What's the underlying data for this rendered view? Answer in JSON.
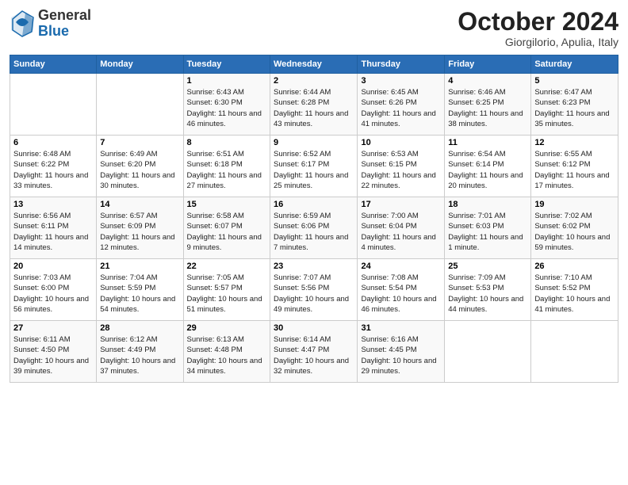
{
  "logo": {
    "general": "General",
    "blue": "Blue"
  },
  "header": {
    "month": "October 2024",
    "location": "Giorgilorio, Apulia, Italy"
  },
  "days_of_week": [
    "Sunday",
    "Monday",
    "Tuesday",
    "Wednesday",
    "Thursday",
    "Friday",
    "Saturday"
  ],
  "weeks": [
    [
      {
        "day": null
      },
      {
        "day": null
      },
      {
        "day": 1,
        "sunrise": "Sunrise: 6:43 AM",
        "sunset": "Sunset: 6:30 PM",
        "daylight": "Daylight: 11 hours and 46 minutes."
      },
      {
        "day": 2,
        "sunrise": "Sunrise: 6:44 AM",
        "sunset": "Sunset: 6:28 PM",
        "daylight": "Daylight: 11 hours and 43 minutes."
      },
      {
        "day": 3,
        "sunrise": "Sunrise: 6:45 AM",
        "sunset": "Sunset: 6:26 PM",
        "daylight": "Daylight: 11 hours and 41 minutes."
      },
      {
        "day": 4,
        "sunrise": "Sunrise: 6:46 AM",
        "sunset": "Sunset: 6:25 PM",
        "daylight": "Daylight: 11 hours and 38 minutes."
      },
      {
        "day": 5,
        "sunrise": "Sunrise: 6:47 AM",
        "sunset": "Sunset: 6:23 PM",
        "daylight": "Daylight: 11 hours and 35 minutes."
      }
    ],
    [
      {
        "day": 6,
        "sunrise": "Sunrise: 6:48 AM",
        "sunset": "Sunset: 6:22 PM",
        "daylight": "Daylight: 11 hours and 33 minutes."
      },
      {
        "day": 7,
        "sunrise": "Sunrise: 6:49 AM",
        "sunset": "Sunset: 6:20 PM",
        "daylight": "Daylight: 11 hours and 30 minutes."
      },
      {
        "day": 8,
        "sunrise": "Sunrise: 6:51 AM",
        "sunset": "Sunset: 6:18 PM",
        "daylight": "Daylight: 11 hours and 27 minutes."
      },
      {
        "day": 9,
        "sunrise": "Sunrise: 6:52 AM",
        "sunset": "Sunset: 6:17 PM",
        "daylight": "Daylight: 11 hours and 25 minutes."
      },
      {
        "day": 10,
        "sunrise": "Sunrise: 6:53 AM",
        "sunset": "Sunset: 6:15 PM",
        "daylight": "Daylight: 11 hours and 22 minutes."
      },
      {
        "day": 11,
        "sunrise": "Sunrise: 6:54 AM",
        "sunset": "Sunset: 6:14 PM",
        "daylight": "Daylight: 11 hours and 20 minutes."
      },
      {
        "day": 12,
        "sunrise": "Sunrise: 6:55 AM",
        "sunset": "Sunset: 6:12 PM",
        "daylight": "Daylight: 11 hours and 17 minutes."
      }
    ],
    [
      {
        "day": 13,
        "sunrise": "Sunrise: 6:56 AM",
        "sunset": "Sunset: 6:11 PM",
        "daylight": "Daylight: 11 hours and 14 minutes."
      },
      {
        "day": 14,
        "sunrise": "Sunrise: 6:57 AM",
        "sunset": "Sunset: 6:09 PM",
        "daylight": "Daylight: 11 hours and 12 minutes."
      },
      {
        "day": 15,
        "sunrise": "Sunrise: 6:58 AM",
        "sunset": "Sunset: 6:07 PM",
        "daylight": "Daylight: 11 hours and 9 minutes."
      },
      {
        "day": 16,
        "sunrise": "Sunrise: 6:59 AM",
        "sunset": "Sunset: 6:06 PM",
        "daylight": "Daylight: 11 hours and 7 minutes."
      },
      {
        "day": 17,
        "sunrise": "Sunrise: 7:00 AM",
        "sunset": "Sunset: 6:04 PM",
        "daylight": "Daylight: 11 hours and 4 minutes."
      },
      {
        "day": 18,
        "sunrise": "Sunrise: 7:01 AM",
        "sunset": "Sunset: 6:03 PM",
        "daylight": "Daylight: 11 hours and 1 minute."
      },
      {
        "day": 19,
        "sunrise": "Sunrise: 7:02 AM",
        "sunset": "Sunset: 6:02 PM",
        "daylight": "Daylight: 10 hours and 59 minutes."
      }
    ],
    [
      {
        "day": 20,
        "sunrise": "Sunrise: 7:03 AM",
        "sunset": "Sunset: 6:00 PM",
        "daylight": "Daylight: 10 hours and 56 minutes."
      },
      {
        "day": 21,
        "sunrise": "Sunrise: 7:04 AM",
        "sunset": "Sunset: 5:59 PM",
        "daylight": "Daylight: 10 hours and 54 minutes."
      },
      {
        "day": 22,
        "sunrise": "Sunrise: 7:05 AM",
        "sunset": "Sunset: 5:57 PM",
        "daylight": "Daylight: 10 hours and 51 minutes."
      },
      {
        "day": 23,
        "sunrise": "Sunrise: 7:07 AM",
        "sunset": "Sunset: 5:56 PM",
        "daylight": "Daylight: 10 hours and 49 minutes."
      },
      {
        "day": 24,
        "sunrise": "Sunrise: 7:08 AM",
        "sunset": "Sunset: 5:54 PM",
        "daylight": "Daylight: 10 hours and 46 minutes."
      },
      {
        "day": 25,
        "sunrise": "Sunrise: 7:09 AM",
        "sunset": "Sunset: 5:53 PM",
        "daylight": "Daylight: 10 hours and 44 minutes."
      },
      {
        "day": 26,
        "sunrise": "Sunrise: 7:10 AM",
        "sunset": "Sunset: 5:52 PM",
        "daylight": "Daylight: 10 hours and 41 minutes."
      }
    ],
    [
      {
        "day": 27,
        "sunrise": "Sunrise: 6:11 AM",
        "sunset": "Sunset: 4:50 PM",
        "daylight": "Daylight: 10 hours and 39 minutes."
      },
      {
        "day": 28,
        "sunrise": "Sunrise: 6:12 AM",
        "sunset": "Sunset: 4:49 PM",
        "daylight": "Daylight: 10 hours and 37 minutes."
      },
      {
        "day": 29,
        "sunrise": "Sunrise: 6:13 AM",
        "sunset": "Sunset: 4:48 PM",
        "daylight": "Daylight: 10 hours and 34 minutes."
      },
      {
        "day": 30,
        "sunrise": "Sunrise: 6:14 AM",
        "sunset": "Sunset: 4:47 PM",
        "daylight": "Daylight: 10 hours and 32 minutes."
      },
      {
        "day": 31,
        "sunrise": "Sunrise: 6:16 AM",
        "sunset": "Sunset: 4:45 PM",
        "daylight": "Daylight: 10 hours and 29 minutes."
      },
      {
        "day": null
      },
      {
        "day": null
      }
    ]
  ]
}
